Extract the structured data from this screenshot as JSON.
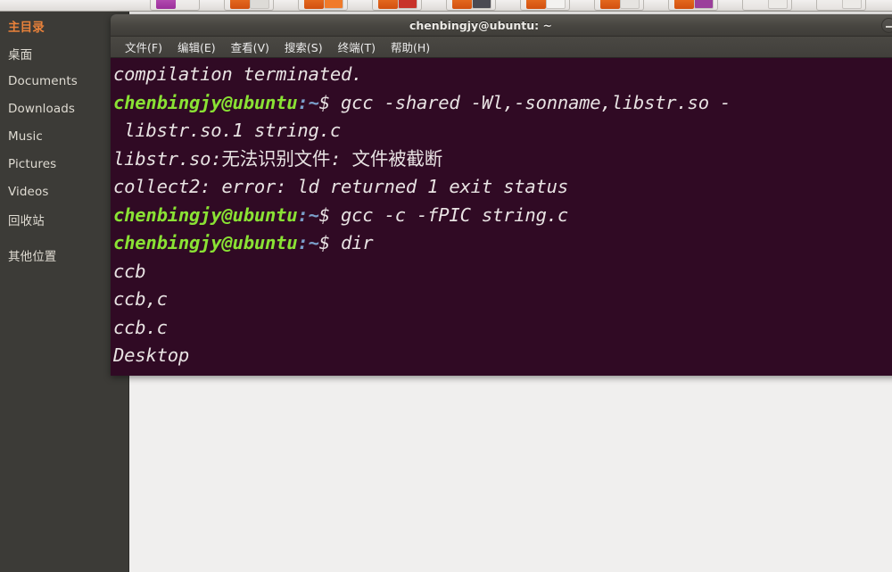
{
  "taskbar": {
    "items": [
      {
        "name": "app-icon-1",
        "kind": "purple"
      },
      {
        "name": "app-icon-2",
        "kind": "orange-doc"
      },
      {
        "name": "app-icon-3",
        "kind": "orange-down"
      },
      {
        "name": "app-icon-4",
        "kind": "orange-red"
      },
      {
        "name": "app-icon-5",
        "kind": "orange-dark"
      },
      {
        "name": "app-icon-6",
        "kind": "orange-white"
      },
      {
        "name": "app-icon-7",
        "kind": "orange-chart"
      },
      {
        "name": "app-icon-8",
        "kind": "orange-purple"
      },
      {
        "name": "app-icon-9",
        "kind": "plain"
      },
      {
        "name": "app-icon-10",
        "kind": "plain"
      }
    ]
  },
  "file_manager": {
    "places": [
      {
        "label": "主目录",
        "selected": true
      },
      {
        "label": "桌面",
        "selected": false
      },
      {
        "label": "Documents",
        "selected": false
      },
      {
        "label": "Downloads",
        "selected": false
      },
      {
        "label": "Music",
        "selected": false
      },
      {
        "label": "Pictures",
        "selected": false
      },
      {
        "label": "Videos",
        "selected": false
      },
      {
        "label": "回收站",
        "selected": false
      },
      {
        "label": "其他位置",
        "selected": false
      }
    ]
  },
  "terminal": {
    "title": "chenbingjy@ubuntu: ~",
    "menu": [
      "文件(F)",
      "编辑(E)",
      "查看(V)",
      "搜索(S)",
      "终端(T)",
      "帮助(H)"
    ],
    "window_buttons": [
      "minimize",
      "maximize"
    ],
    "colors": {
      "background": "#300a24",
      "foreground": "#e8e3e3",
      "prompt_user": "#8ae234",
      "prompt_path": "#7a9ec9",
      "titlebar": "#474540"
    },
    "prompt": {
      "user": "chenbingjy@ubuntu",
      "path": ":~",
      "symbol": "$"
    },
    "lines": [
      {
        "type": "output",
        "text": "compilation terminated."
      },
      {
        "type": "prompt",
        "command": " gcc -shared -Wl,-sonname,libstr.so -"
      },
      {
        "type": "output",
        "text": " libstr.so.1 string.c"
      },
      {
        "type": "output",
        "text": "libstr.so:无法识别文件: 文件被截断"
      },
      {
        "type": "output",
        "text": "collect2: error: ld returned 1 exit status"
      },
      {
        "type": "prompt",
        "command": " gcc -c -fPIC string.c"
      },
      {
        "type": "prompt",
        "command": " dir"
      },
      {
        "type": "output",
        "text": "ccb"
      },
      {
        "type": "output",
        "text": "ccb,c"
      },
      {
        "type": "output",
        "text": "ccb.c"
      },
      {
        "type": "output",
        "text": "Desktop"
      }
    ]
  }
}
